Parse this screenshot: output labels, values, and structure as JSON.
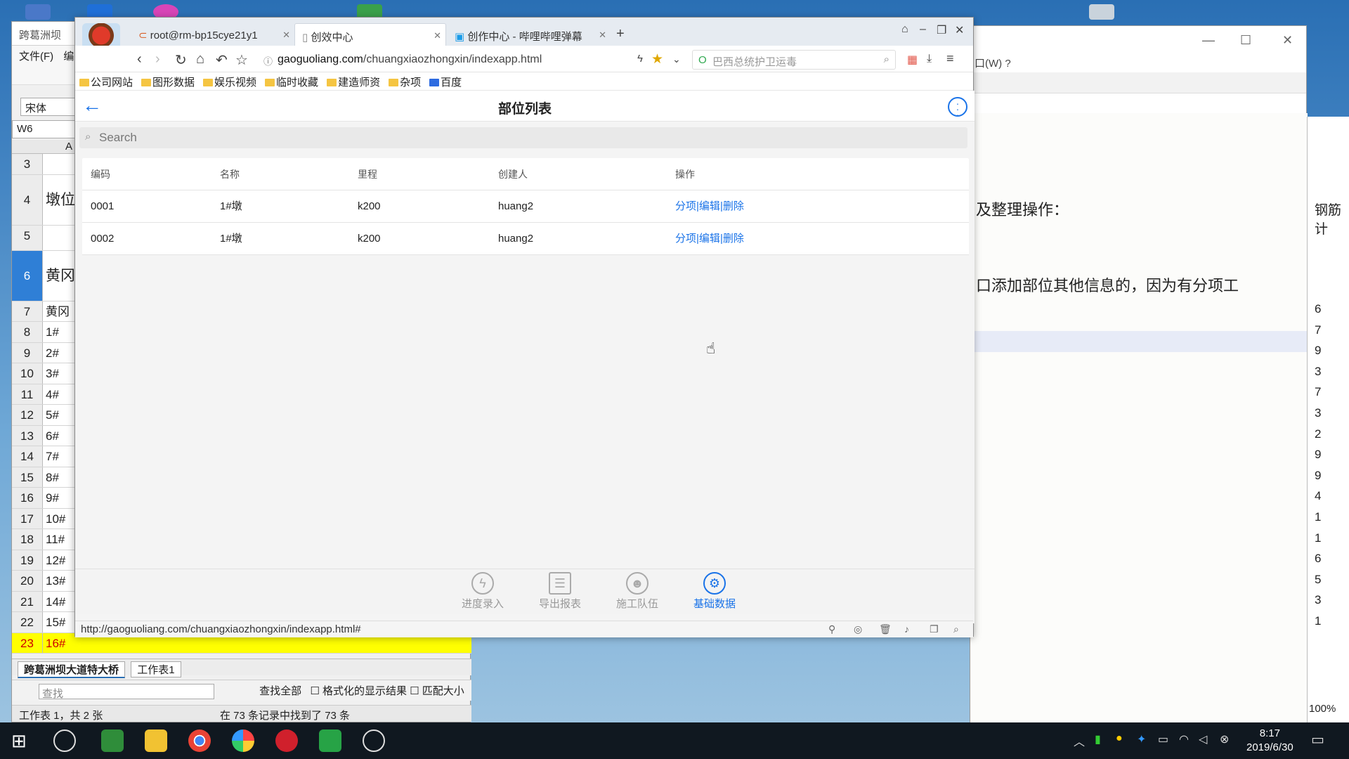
{
  "spreadsheet": {
    "title": "跨葛洲坝",
    "menu": [
      "文件(F)",
      "编"
    ],
    "font_box": "宋体",
    "name_box": "W6",
    "column_header": "A",
    "rows": [
      {
        "n": "3",
        "text": ""
      },
      {
        "n": "4",
        "text": "墩位"
      },
      {
        "n": "5",
        "text": ""
      },
      {
        "n": "6",
        "text": "黄冈"
      },
      {
        "n": "7",
        "text": "黄冈"
      },
      {
        "n": "8",
        "text": "1#"
      },
      {
        "n": "9",
        "text": "2#"
      },
      {
        "n": "10",
        "text": "3#"
      },
      {
        "n": "11",
        "text": "4#"
      },
      {
        "n": "12",
        "text": "5#"
      },
      {
        "n": "13",
        "text": "6#"
      },
      {
        "n": "14",
        "text": "7#"
      },
      {
        "n": "15",
        "text": "8#"
      },
      {
        "n": "16",
        "text": "9#"
      },
      {
        "n": "17",
        "text": "10#"
      },
      {
        "n": "18",
        "text": "11#"
      },
      {
        "n": "19",
        "text": "12#"
      },
      {
        "n": "20",
        "text": "13#"
      },
      {
        "n": "21",
        "text": "14#"
      },
      {
        "n": "22",
        "text": "15#"
      },
      {
        "n": "23",
        "text": "16#"
      }
    ],
    "sheet_tabs": [
      "跨葛洲坝大道特大桥",
      "工作表1"
    ],
    "find_placeholder": "查找",
    "find_all": "查找全部",
    "opt_formatted": "格式化的显示结果",
    "opt_match_case": "匹配大小",
    "status_left": "工作表 1，共 2 张",
    "status_right": "在 73 条记录中找到了 73 条"
  },
  "document": {
    "menu_tail": "口(W)   ?",
    "para1": "及整理操作：",
    "para2": "口添加部位其他信息的，因为有分项工",
    "right_col_top": "钢筋计",
    "right_col_values": [
      "6",
      "7",
      "9",
      "3",
      "7",
      "3",
      "2",
      "9",
      "9",
      "4",
      "1",
      "1",
      "6",
      "5",
      "3",
      "1"
    ],
    "zoom": "100%"
  },
  "browser": {
    "tabs": [
      {
        "label": "root@rm-bp15cye21y1"
      },
      {
        "label": "创效中心"
      },
      {
        "label": "创作中心 - 哔哩哔哩弹幕"
      }
    ],
    "url_host": "gaoguoliang.com",
    "url_path": "/chuangxiaozhongxin/indexapp.html",
    "search_placeholder": "巴西总统护卫运毒",
    "bookmarks": [
      "公司网站",
      "图形数据",
      "娱乐视频",
      "临时收藏",
      "建造师资",
      "杂项",
      "百度"
    ],
    "status_url": "http://gaoguoliang.com/chuangxiaozhongxin/indexapp.html#"
  },
  "app": {
    "page_title": "部位列表",
    "search_placeholder": "Search",
    "columns": [
      "编码",
      "名称",
      "里程",
      "创建人",
      "操作"
    ],
    "rows": [
      {
        "code": "0001",
        "name": "1#墩",
        "mileage": "k200",
        "creator": "huang2"
      },
      {
        "code": "0002",
        "name": "1#墩",
        "mileage": "k200",
        "creator": "huang2"
      }
    ],
    "actions": {
      "split": "分项",
      "edit": "编辑",
      "delete": "删除",
      "separator": "|"
    },
    "bottom_nav": [
      {
        "label": "进度录入",
        "icon": "lightning-icon"
      },
      {
        "label": "导出报表",
        "icon": "list-icon"
      },
      {
        "label": "施工队伍",
        "icon": "team-icon"
      },
      {
        "label": "基础数据",
        "icon": "gear-icon"
      }
    ],
    "accent_color": "#1a73e8"
  },
  "taskbar": {
    "time": "8:17",
    "date": "2019/6/30"
  }
}
